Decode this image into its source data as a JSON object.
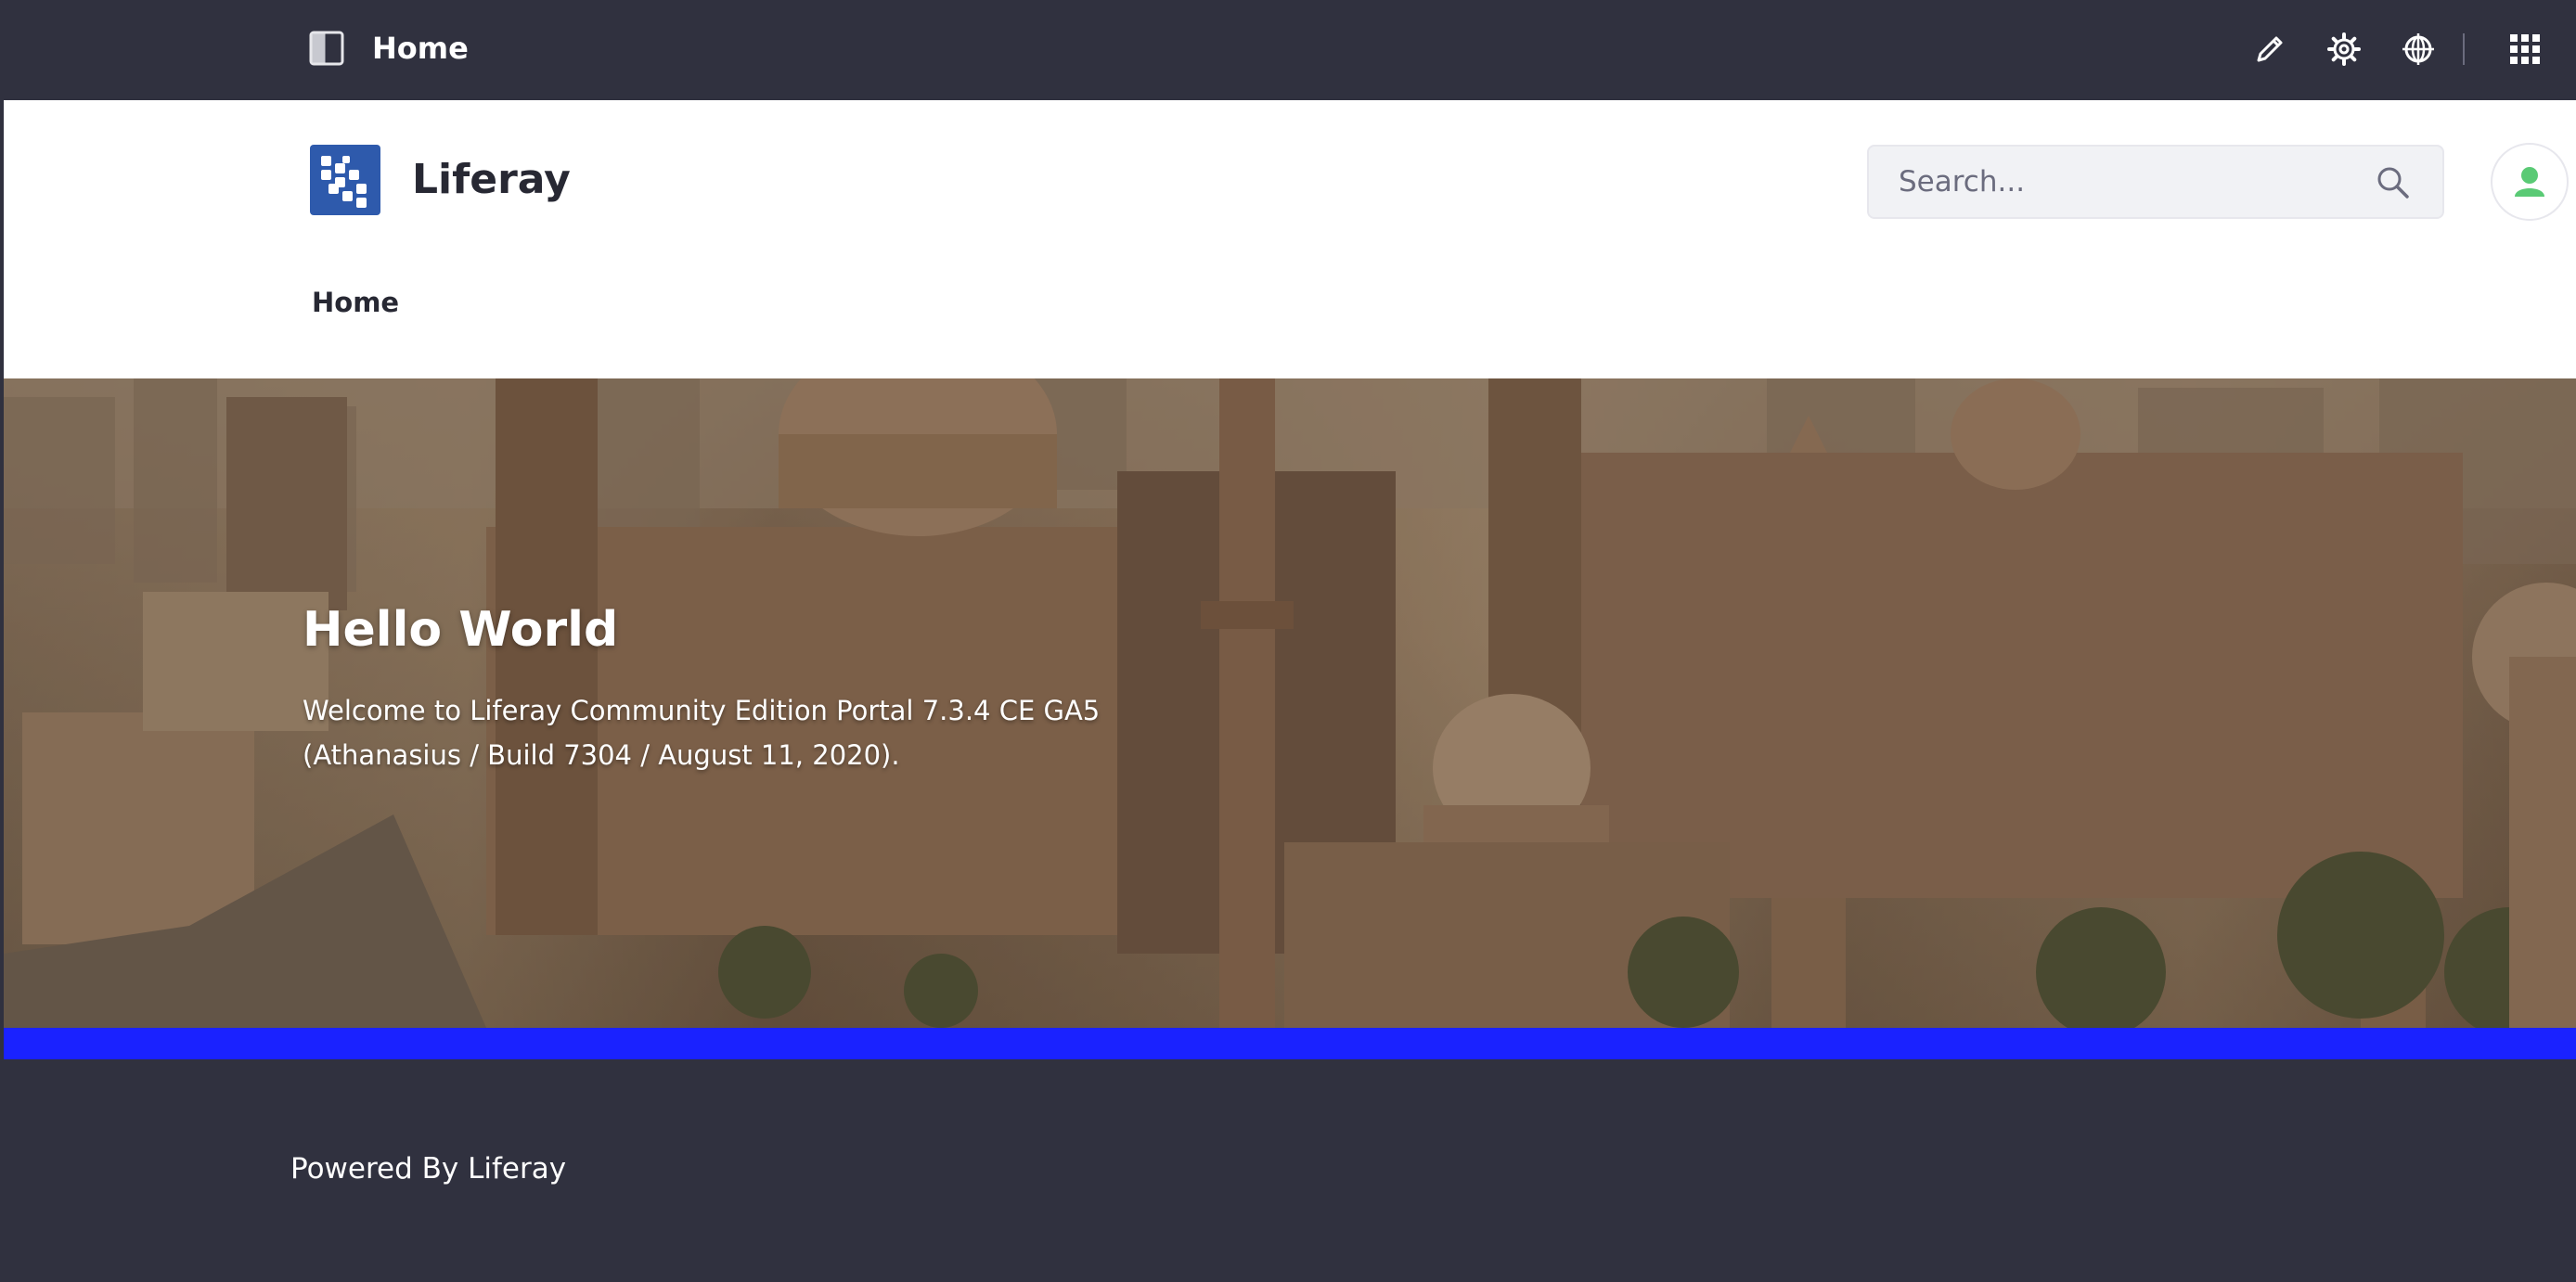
{
  "control_menu": {
    "title": "Home",
    "icons": [
      "sidebar-toggle-icon",
      "pencil-icon",
      "gear-icon",
      "globe-target-icon",
      "apps-grid-icon"
    ]
  },
  "header": {
    "site_name": "Liferay",
    "search_placeholder": "Search...",
    "nav": [
      {
        "label": "Home"
      }
    ]
  },
  "hero": {
    "title": "Hello World",
    "text_line_1": "Welcome to Liferay Community Edition Portal 7.3.4 CE GA5",
    "text_line_2": "(Athanasius / Build 7304 / August 11, 2020)."
  },
  "footer": {
    "text": "Powered By Liferay"
  },
  "colors": {
    "control_menu_bg": "#30313f",
    "logo_bg": "#2e5aac",
    "accent_strip": "#1a22ff",
    "avatar_green": "#5aca75"
  }
}
